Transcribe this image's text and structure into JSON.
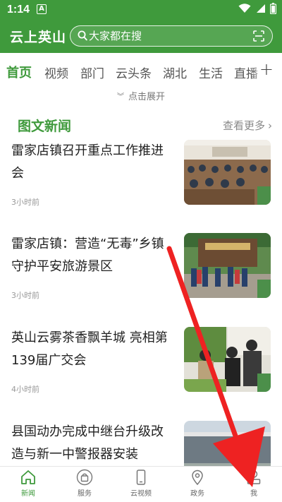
{
  "status_bar": {
    "time": "1:14",
    "notification_badge": "A"
  },
  "header": {
    "title": "云上英山",
    "search": {
      "placeholder": "大家都在搜",
      "icon": "search-icon",
      "right_icon": "scan-icon"
    }
  },
  "tabs": [
    {
      "label": "首页",
      "active": true
    },
    {
      "label": "视频"
    },
    {
      "label": "部门"
    },
    {
      "label": "云头条"
    },
    {
      "label": "湖北"
    },
    {
      "label": "生活"
    },
    {
      "label": "直播"
    }
  ],
  "add_channel": "+",
  "expand_label": "点击展开",
  "section": {
    "title": "图文新闻",
    "more": "查看更多"
  },
  "news": [
    {
      "headline": "雷家店镇召开重点工作推进会",
      "time": "3小时前",
      "thumb": "meeting-hall-photo"
    },
    {
      "headline": "雷家店镇：营造“无毒”乡镇守护平安旅游景区",
      "time": "3小时前",
      "thumb": "scenic-gate-photo"
    },
    {
      "headline": "英山云雾茶香飘羊城 亮相第139届广交会",
      "time": "4小时前",
      "thumb": "trade-fair-photo"
    },
    {
      "headline": "县国动办完成中继台升级改造与新一中警报器安装",
      "time": "",
      "thumb": "building-photo"
    }
  ],
  "bottom_nav": [
    {
      "label": "新闻",
      "icon": "home-icon",
      "active": true
    },
    {
      "label": "服务",
      "icon": "bag-icon"
    },
    {
      "label": "云视频",
      "icon": "phone-icon"
    },
    {
      "label": "政务",
      "icon": "location-pin-icon"
    },
    {
      "label": "我",
      "icon": "person-icon"
    }
  ],
  "colors": {
    "brand_green": "#3f9a3c",
    "annotation_red": "#ee2222"
  }
}
